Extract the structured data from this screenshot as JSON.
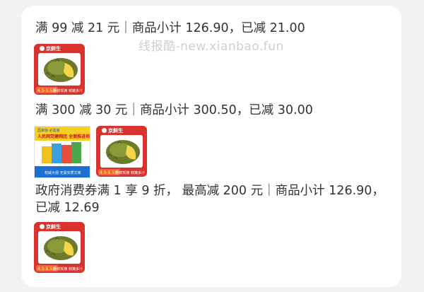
{
  "promos": [
    {
      "text": "满 99 减 21 元｜商品小计 126.90，已减 21.00"
    },
    {
      "text": "满 300 减 30 元｜商品小计 300.50，已减 30.00"
    },
    {
      "text_line1": "政府消费券满 1 享 9 折，  最高减 200 元｜商品小计 126.90，",
      "text_line2": "已减 12.69"
    }
  ],
  "watermark": "线报酷-new.xianbao.fun",
  "product_thumb": {
    "brand": "京鲜生",
    "price_tag": "4.5-5.5斤",
    "footer": "新鲜现摘 鲜嫩多汁"
  },
  "book_thumb": {
    "tag": "国家版 必需版",
    "headline": "人民网党建网团 全面推进司品牌",
    "footer": "权威大观 无需实质文库"
  },
  "colors": {
    "accent": "#d8332d",
    "background": "#f2f2f2"
  }
}
